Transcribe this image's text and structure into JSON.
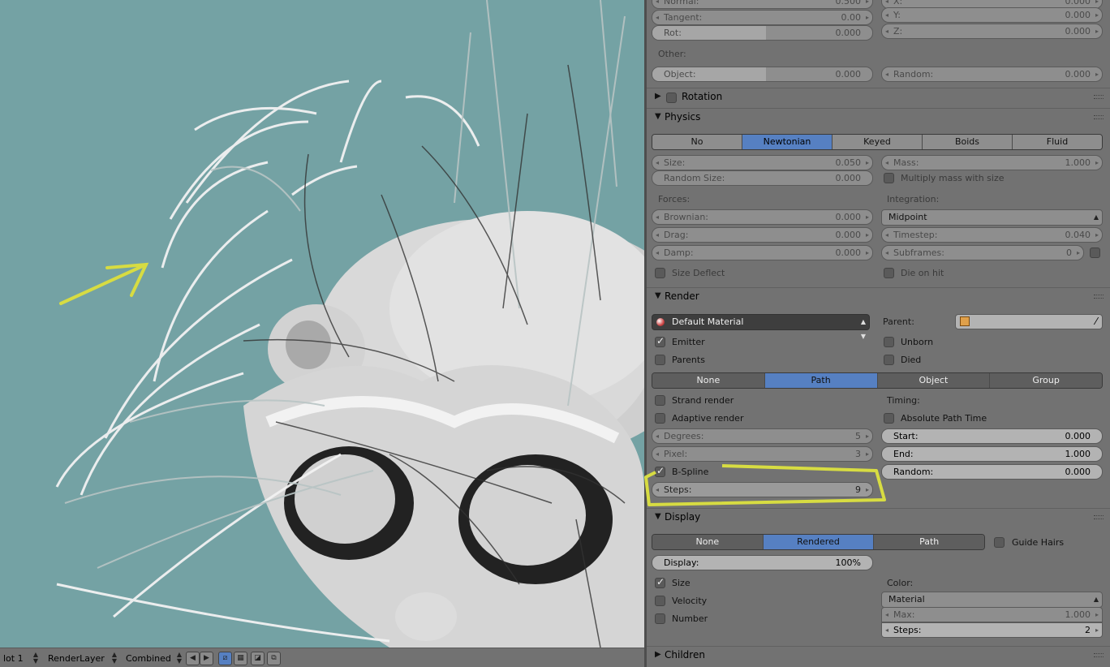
{
  "viewport": {
    "annotation_color": "#d7dc42"
  },
  "statusbar": {
    "slot": "lot 1",
    "layer": "RenderLayer",
    "pass": "Combined"
  },
  "velocity": {
    "normal_label": "Normal:",
    "normal_value": "0.500",
    "tangent_label": "Tangent:",
    "tangent_value": "0.00",
    "rot_label": "Rot:",
    "rot_value": "0.000",
    "x_label": "X:",
    "x_value": "0.000",
    "y_label": "Y:",
    "y_value": "0.000",
    "z_label": "Z:",
    "z_value": "0.000",
    "other_label": "Other:",
    "object_label": "Object:",
    "object_value": "0.000",
    "random_label": "Random:",
    "random_value": "0.000"
  },
  "rotation": {
    "title": "Rotation"
  },
  "physics": {
    "title": "Physics",
    "tabs": [
      "No",
      "Newtonian",
      "Keyed",
      "Boids",
      "Fluid"
    ],
    "active_tab": "Newtonian",
    "size_label": "Size:",
    "size_value": "0.050",
    "random_size_label": "Random Size:",
    "random_size_value": "0.000",
    "mass_label": "Mass:",
    "mass_value": "1.000",
    "multiply_mass": "Multiply mass with size",
    "forces_label": "Forces:",
    "integration_label": "Integration:",
    "brownian_label": "Brownian:",
    "brownian_value": "0.000",
    "drag_label": "Drag:",
    "drag_value": "0.000",
    "damp_label": "Damp:",
    "damp_value": "0.000",
    "integration_value": "Midpoint",
    "timestep_label": "Timestep:",
    "timestep_value": "0.040",
    "subframes_label": "Subframes:",
    "subframes_value": "0",
    "size_deflect": "Size Deflect",
    "die_on_hit": "Die on hit"
  },
  "render": {
    "title": "Render",
    "material": "Default Material",
    "parent_label": "Parent:",
    "emitter": "Emitter",
    "emitter_checked": true,
    "unborn": "Unborn",
    "parents": "Parents",
    "died": "Died",
    "tabs": [
      "None",
      "Path",
      "Object",
      "Group"
    ],
    "active_tab": "Path",
    "strand_render": "Strand render",
    "adaptive_render": "Adaptive render",
    "timing_label": "Timing:",
    "absolute_path_time": "Absolute Path Time",
    "degrees_label": "Degrees:",
    "degrees_value": "5",
    "pixel_label": "Pixel:",
    "pixel_value": "3",
    "start_label": "Start:",
    "start_value": "0.000",
    "end_label": "End:",
    "end_value": "1.000",
    "bspline": "B-Spline",
    "bspline_checked": true,
    "random_label": "Random:",
    "random_value": "0.000",
    "steps_label": "Steps:",
    "steps_value": "9"
  },
  "display": {
    "title": "Display",
    "tabs": [
      "None",
      "Rendered",
      "Path"
    ],
    "active_tab": "Rendered",
    "guide_hairs": "Guide Hairs",
    "display_label": "Display:",
    "display_value": "100%",
    "size": "Size",
    "size_checked": true,
    "velocity": "Velocity",
    "number": "Number",
    "color_label": "Color:",
    "color_value": "Material",
    "max_label": "Max:",
    "max_value": "1.000",
    "steps_label": "Steps:",
    "steps_value": "2"
  },
  "children": {
    "title": "Children"
  }
}
